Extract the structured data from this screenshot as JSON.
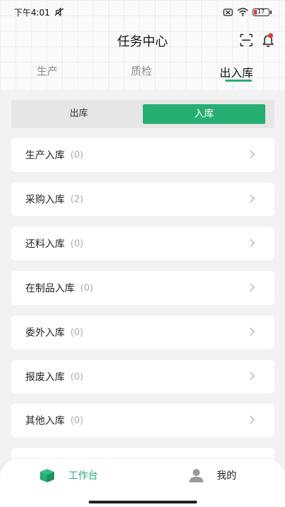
{
  "status_bar": {
    "time": "下午4:01",
    "battery_level": "17",
    "colors": {
      "battery_low": "#e53935"
    },
    "icons": [
      "mute-icon",
      "sim-off-icon",
      "wifi-icon",
      "battery-icon"
    ]
  },
  "header": {
    "title": "任务中心",
    "icons": [
      "scan-icon",
      "bell-icon"
    ],
    "colors": {
      "notification_dot": "#e53935"
    }
  },
  "tabs": [
    {
      "label": "生产",
      "active": false
    },
    {
      "label": "质检",
      "active": false
    },
    {
      "label": "出入库",
      "active": true
    }
  ],
  "segment": {
    "options": [
      "出库",
      "入库"
    ],
    "selected": "入库",
    "accent": "#27ae73"
  },
  "list": [
    {
      "label": "生产入库",
      "count": "(0)"
    },
    {
      "label": "采购入库",
      "count": "(2)"
    },
    {
      "label": "还料入库",
      "count": "(0)"
    },
    {
      "label": "在制品入库",
      "count": "(0)"
    },
    {
      "label": "委外入库",
      "count": "(0)"
    },
    {
      "label": "报废入库",
      "count": "(0)"
    },
    {
      "label": "其他入库",
      "count": "(0)"
    }
  ],
  "bottom_nav": [
    {
      "label": "工作台",
      "icon": "workbench-icon",
      "active": true
    },
    {
      "label": "我的",
      "icon": "user-icon",
      "active": false
    }
  ]
}
